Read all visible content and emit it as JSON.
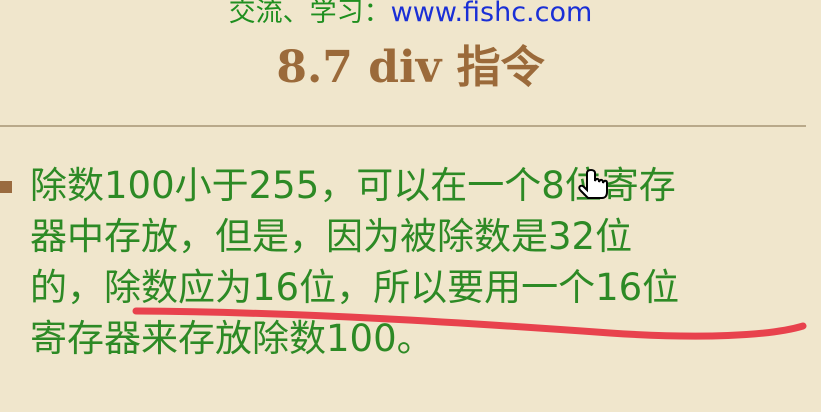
{
  "header": {
    "prefix": "交流、学习：",
    "url": "www.fishc.com"
  },
  "title": "8.7 div 指令",
  "content": {
    "lines": [
      "除数100小于255，可以在一个8位寄存",
      "器中存放，但是，因为被除数是32位",
      "的，除数应为16位，所以要用一个16位",
      "寄存器来存放除数100。"
    ]
  },
  "colors": {
    "background": "#f0e6cc",
    "header_text": "#1f8f1f",
    "link": "#1a2fd6",
    "title": "#9b6a3a",
    "body_text": "#2d8a25",
    "annotation": "#e8424d"
  },
  "icons": {
    "bullet": "square-bullet-icon",
    "cursor": "hand-pointer-cursor-icon"
  }
}
